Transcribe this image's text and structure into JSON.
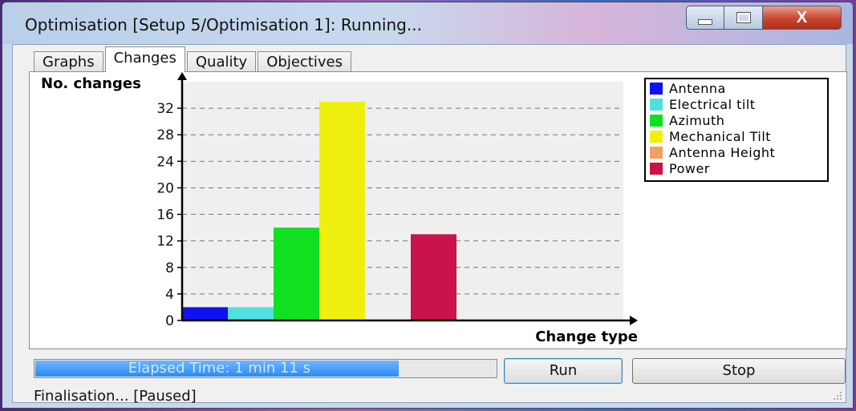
{
  "window": {
    "title": "Optimisation [Setup 5/Optimisation 1]: Running...",
    "minimize_glyph": "",
    "maximize_glyph": "",
    "close_glyph": "X"
  },
  "tabs": [
    {
      "label": "Graphs",
      "active": false
    },
    {
      "label": "Changes",
      "active": true
    },
    {
      "label": "Quality",
      "active": false
    },
    {
      "label": "Objectives",
      "active": false
    }
  ],
  "chart_data": {
    "type": "bar",
    "ylabel": "No. changes",
    "xlabel": "Change type",
    "ylim": [
      0,
      36
    ],
    "yticks": [
      0,
      4,
      8,
      12,
      16,
      20,
      24,
      28,
      32
    ],
    "grid": "horizontal dashed",
    "legend_placement": "top-right",
    "categories": [
      "Antenna",
      "Electrical tilt",
      "Azimuth",
      "Mechanical Tilt",
      "Antenna Height",
      "Power"
    ],
    "values": [
      2,
      2,
      14,
      33,
      0,
      13
    ],
    "colors": [
      "#1010f0",
      "#50e0e0",
      "#10e020",
      "#f0f010",
      "#f0a060",
      "#c8144a"
    ]
  },
  "progress": {
    "label": "Elapsed Time: 1 min 11 s",
    "fraction": 0.79
  },
  "buttons": {
    "run": "Run",
    "stop": "Stop"
  },
  "status": {
    "text": "Finalisation... [Paused]"
  },
  "colors": {
    "progress_fill": "#2a8cf0",
    "close_button": "#c8452f"
  }
}
